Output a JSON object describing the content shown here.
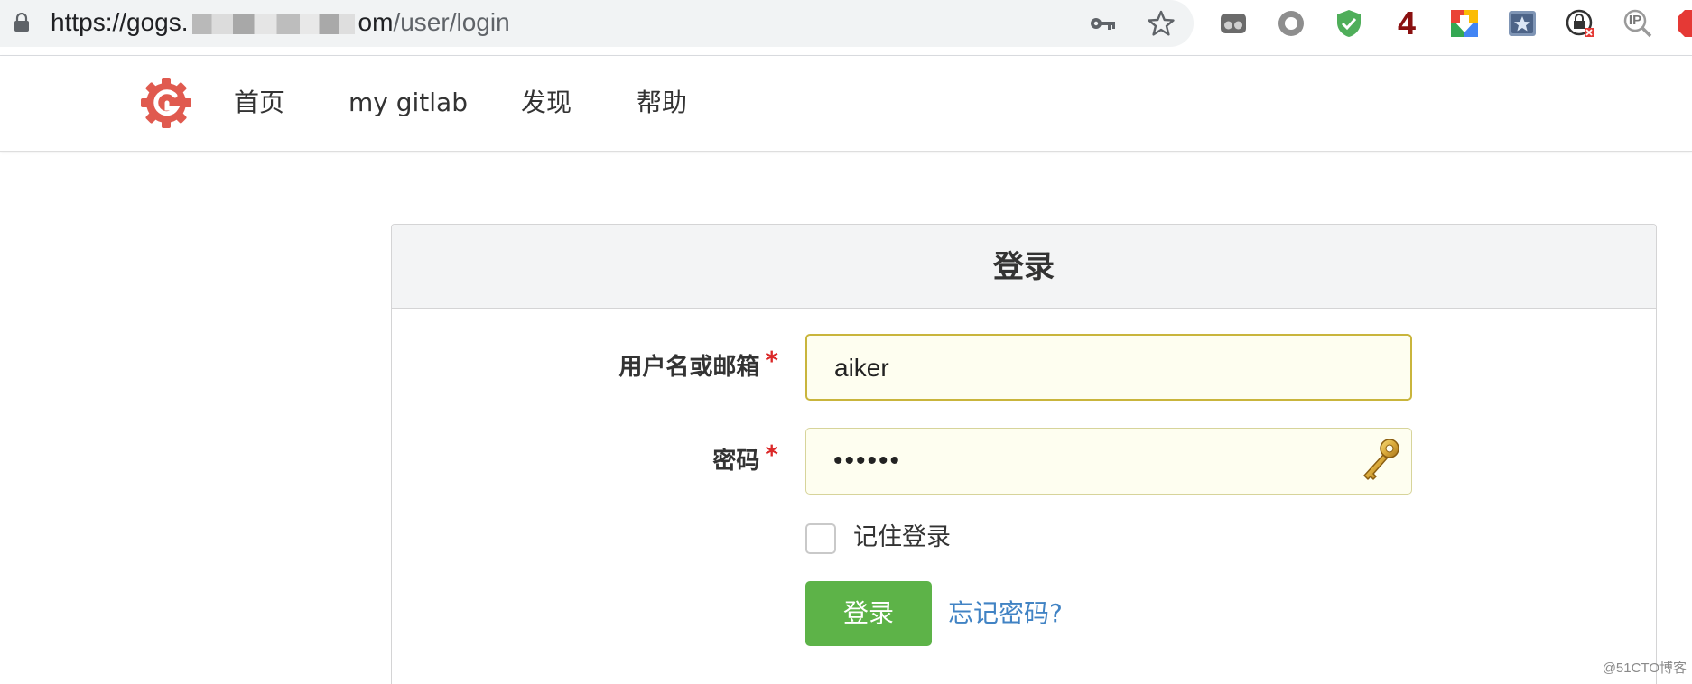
{
  "browser": {
    "url_host_prefix": "https://gogs.",
    "url_host_suffix": "om",
    "url_path": "/user/login",
    "extension_badge_number": "4",
    "ip_badge_text": "IP"
  },
  "nav": {
    "items": [
      {
        "label": "首页"
      },
      {
        "label": "my gitlab"
      },
      {
        "label": "发现"
      },
      {
        "label": "帮助"
      }
    ]
  },
  "login": {
    "title": "登录",
    "username_label": "用户名或邮箱",
    "username_value": "aiker",
    "password_label": "密码",
    "password_value": "••••••",
    "required_mark": "*",
    "remember_label": "记住登录",
    "remember_checked": false,
    "submit_label": "登录",
    "forgot_label": "忘记密码?"
  },
  "watermark": "@51CTO博客",
  "colors": {
    "brand_logo": "#e05a4f",
    "primary_button": "#5db348",
    "link": "#4183c4",
    "required": "#db2828",
    "input_bg": "#fefef0"
  }
}
